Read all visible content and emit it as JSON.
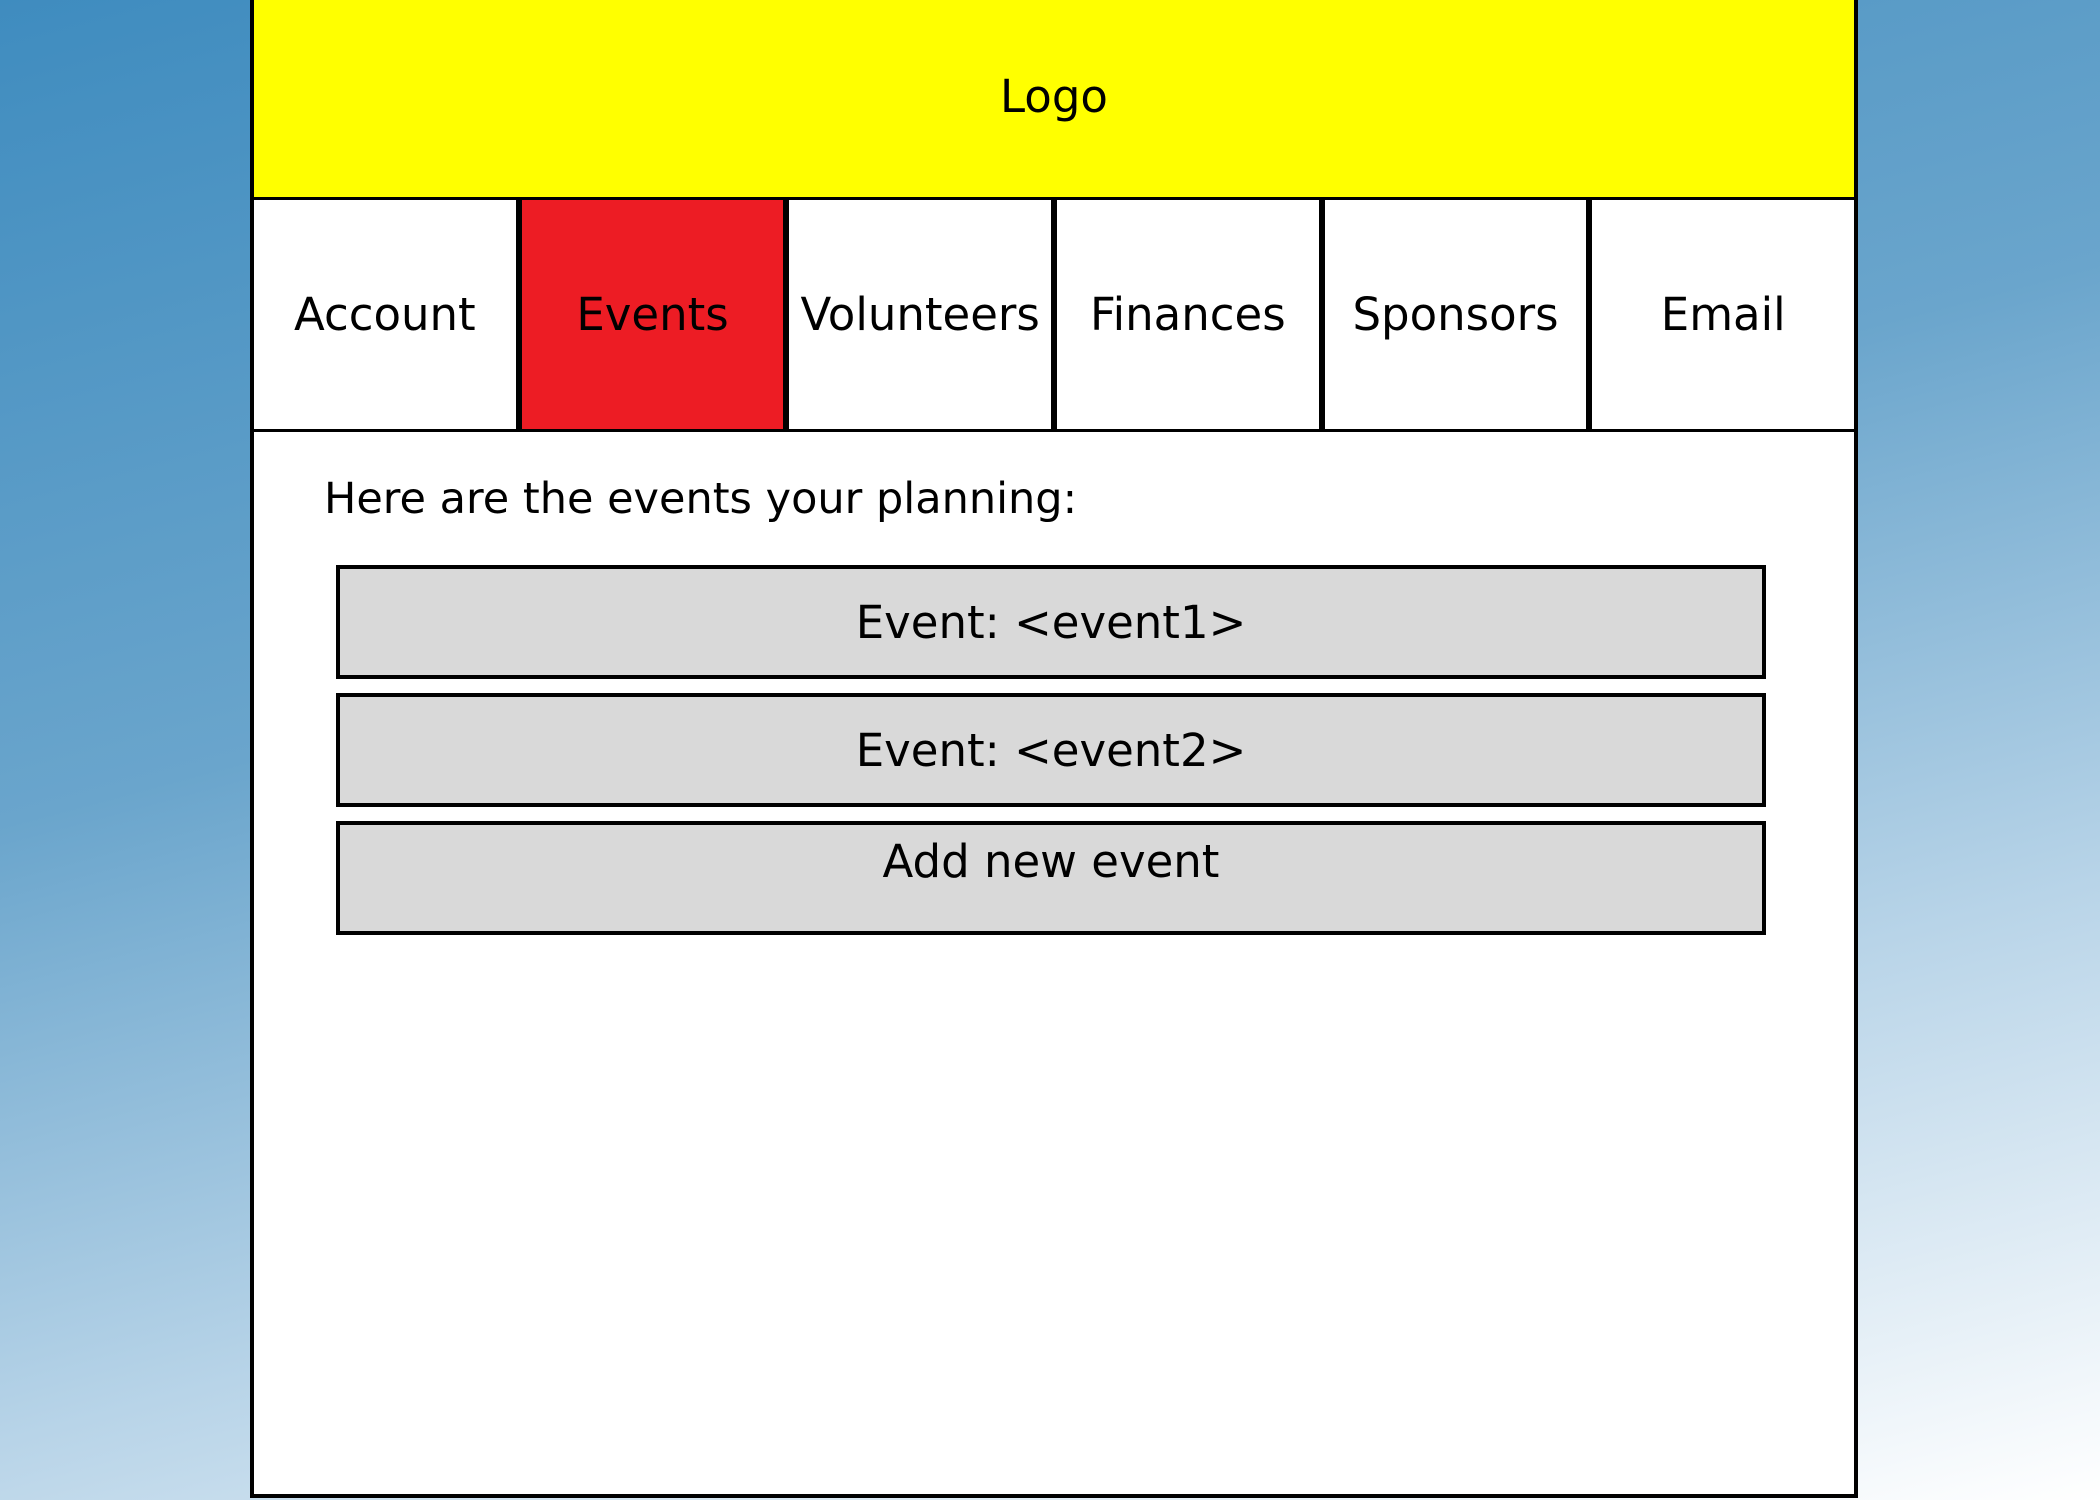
{
  "header": {
    "logo_text": "Logo"
  },
  "nav": {
    "tabs": [
      {
        "label": "Account"
      },
      {
        "label": "Events"
      },
      {
        "label": "Volunteers"
      },
      {
        "label": "Finances"
      },
      {
        "label": "Sponsors"
      },
      {
        "label": "Email"
      }
    ],
    "active_tab": "Events"
  },
  "main": {
    "intro_text": "Here are the events your planning:",
    "events": [
      {
        "label": "Event: <event1>"
      },
      {
        "label": "Event: <event2>"
      }
    ],
    "add_button_label": "Add new event"
  },
  "colors": {
    "header_bg": "#ffff00",
    "active_tab_bg": "#ed1c24",
    "button_bg": "#d9d9d9"
  }
}
